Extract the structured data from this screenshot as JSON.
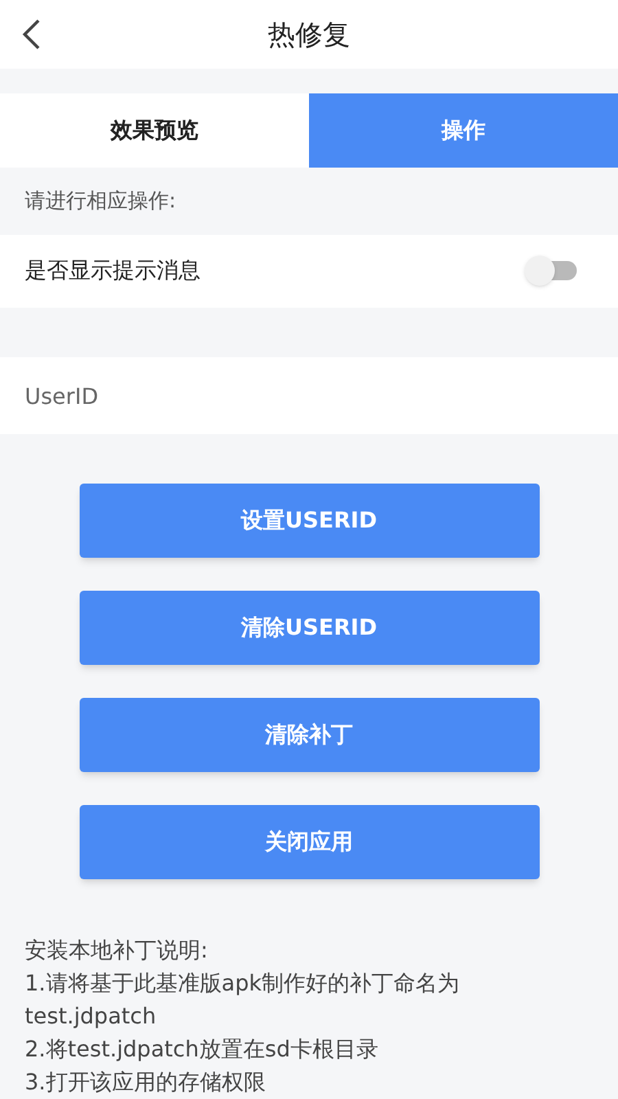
{
  "header": {
    "title": "热修复"
  },
  "tabs": [
    {
      "label": "效果预览",
      "selected": false
    },
    {
      "label": "操作",
      "selected": true
    }
  ],
  "prompt": "请进行相应操作:",
  "toggle": {
    "label": "是否显示提示消息",
    "on": false
  },
  "userid_field": {
    "placeholder": "UserID"
  },
  "buttons": [
    "设置USERID",
    "清除USERID",
    "清除补丁",
    "关闭应用"
  ],
  "instructions": [
    "安装本地补丁说明:",
    "1.请将基于此基准版apk制作好的补丁命名为test.jdpatch",
    "2.将test.jdpatch放置在sd卡根目录",
    "3.打开该应用的存储权限"
  ]
}
